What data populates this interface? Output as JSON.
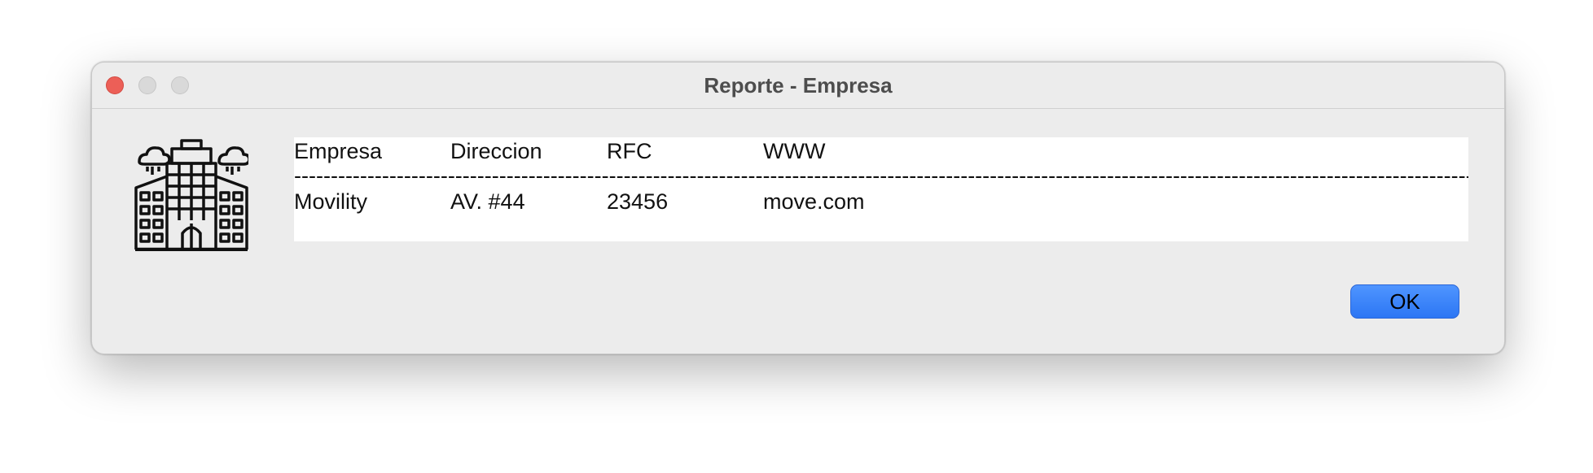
{
  "window": {
    "title": "Reporte - Empresa"
  },
  "icon": {
    "name": "office-building-icon"
  },
  "report": {
    "columns": [
      "Empresa",
      "Direccion",
      "RFC",
      "WWW"
    ],
    "divider": "--------------------------------------------------------------------------------------------------------------------------------------------------------------------------------------------------------------",
    "rows": [
      [
        "Movility",
        "AV. #44",
        "23456",
        "move.com"
      ]
    ]
  },
  "buttons": {
    "ok_label": "OK"
  },
  "colors": {
    "close": "#ec5f57",
    "accent": "#2c76f4",
    "window_bg": "#ececec"
  }
}
